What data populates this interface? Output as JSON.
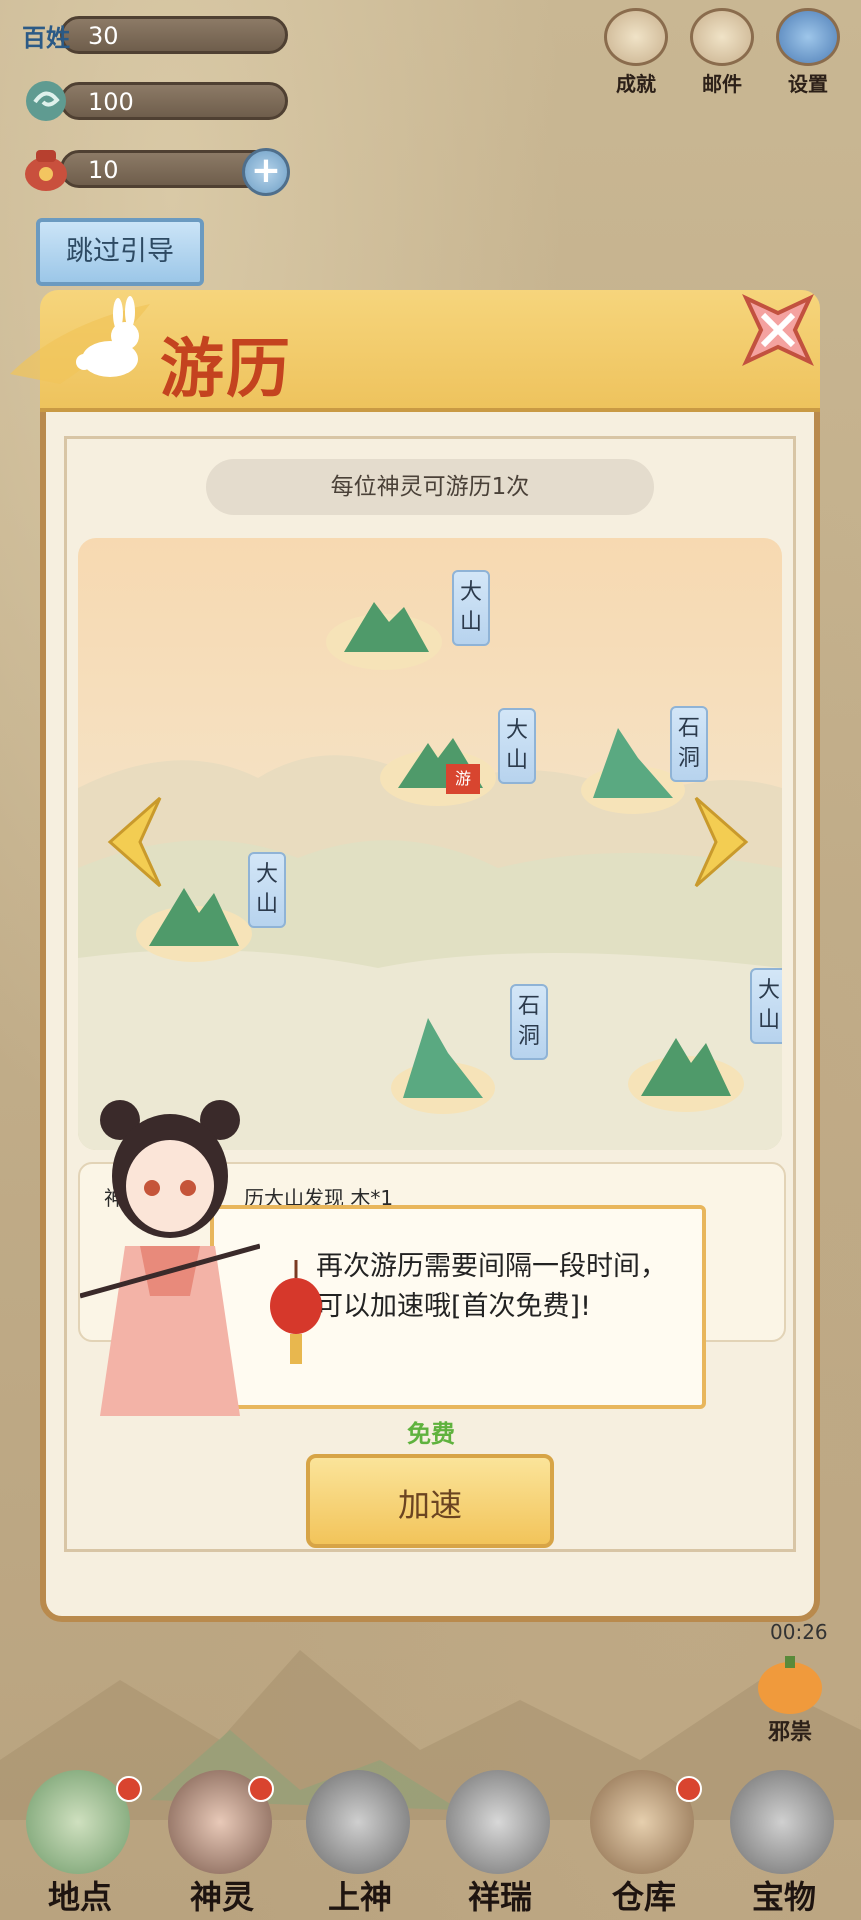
{
  "resources": [
    {
      "label": "百姓",
      "value": "30"
    },
    {
      "value": "100"
    },
    {
      "value": "10",
      "plus": "+"
    }
  ],
  "top_buttons": [
    "成就",
    "邮件",
    "设置"
  ],
  "skip_button": "跳过引导",
  "panel": {
    "title": "游历",
    "notice": "每位神灵可游历1次",
    "locations": [
      {
        "name": "大山"
      },
      {
        "name": "大山",
        "flag": "游"
      },
      {
        "name": "石洞"
      },
      {
        "name": "大山"
      },
      {
        "name": "石洞"
      },
      {
        "name": "大山"
      }
    ],
    "log_text": "神",
    "log_text2": "历大山发现 木*1",
    "dialog": "再次游历需要间隔一段时间，可以加速哦[首次免费]!",
    "free_label": "免费",
    "speed_button": "加速"
  },
  "timer": "00:26",
  "evil_label": "邪祟",
  "nav": [
    "地点",
    "神灵",
    "上神",
    "祥瑞",
    "仓库",
    "宝物"
  ]
}
